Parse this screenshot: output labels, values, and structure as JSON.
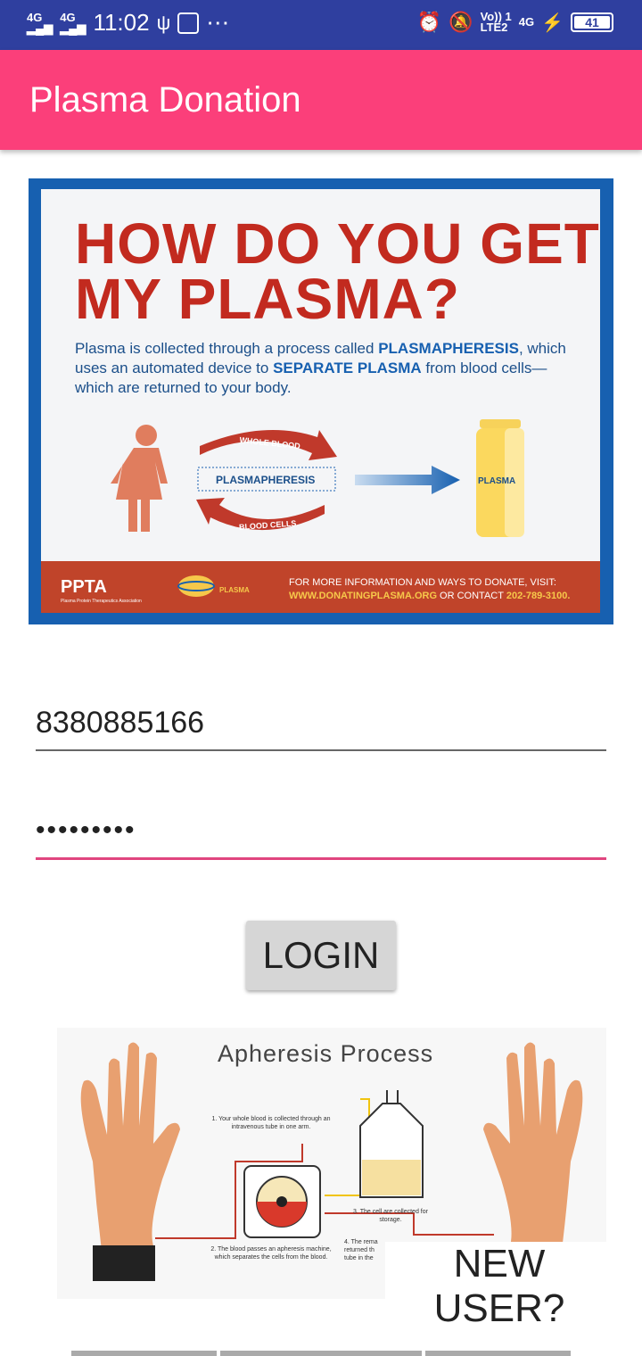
{
  "status_bar": {
    "time": "11:02",
    "network1": "4G",
    "network2": "4G",
    "volte": "Vo)) 1",
    "lte": "LTE2",
    "net_right": "4G",
    "battery": "41",
    "icons": [
      "signal-icon",
      "usb-icon",
      "app-icon",
      "more-icon",
      "alarm-icon",
      "mute-icon",
      "charging-icon",
      "battery-icon"
    ]
  },
  "app_bar": {
    "title": "Plasma Donation",
    "color": "#fb3f7a"
  },
  "banner": {
    "title_line1": "HOW DO YOU GET",
    "title_line2": "MY PLASMA?",
    "text_part1": "Plasma is collected through a process called ",
    "text_bold1": "PLASMAPHERESIS",
    "text_part2": ", which uses an automated device to ",
    "text_bold2": "SEPARATE PLASMA",
    "text_part3": " from blood cells—which are returned to your body.",
    "whole_blood": "WHOLE BLOOD",
    "plasmapheresis": "PLASMAPHERESIS",
    "blood_cells": "BLOOD CELLS",
    "plasma_label": "PLASMA",
    "logo_ppta": "PPTA",
    "logo_ppta_sub": "Plasma Protein Therapeutics Association",
    "logo_donating": "PLASMA",
    "footer_line1": "FOR MORE INFORMATION AND WAYS TO DONATE, VISIT:",
    "footer_url": "WWW.DONATINGPLASMA.ORG",
    "footer_or": " OR CONTACT ",
    "footer_phone": "202-789-3100."
  },
  "form": {
    "phone_value": "8380885166",
    "password_value": "•••••••••",
    "login_label": "LOGIN"
  },
  "apheresis": {
    "title": "Apheresis Process",
    "step1": "1. Your whole blood is collected through an intravenous tube in one arm.",
    "step2": "2. The blood passes an apheresis machine, which separates the cells from the blood.",
    "step3": "3. The cell are collected for storage.",
    "step4": "4. The rema returned th tube in the"
  },
  "new_user_label": "NEW USER?"
}
